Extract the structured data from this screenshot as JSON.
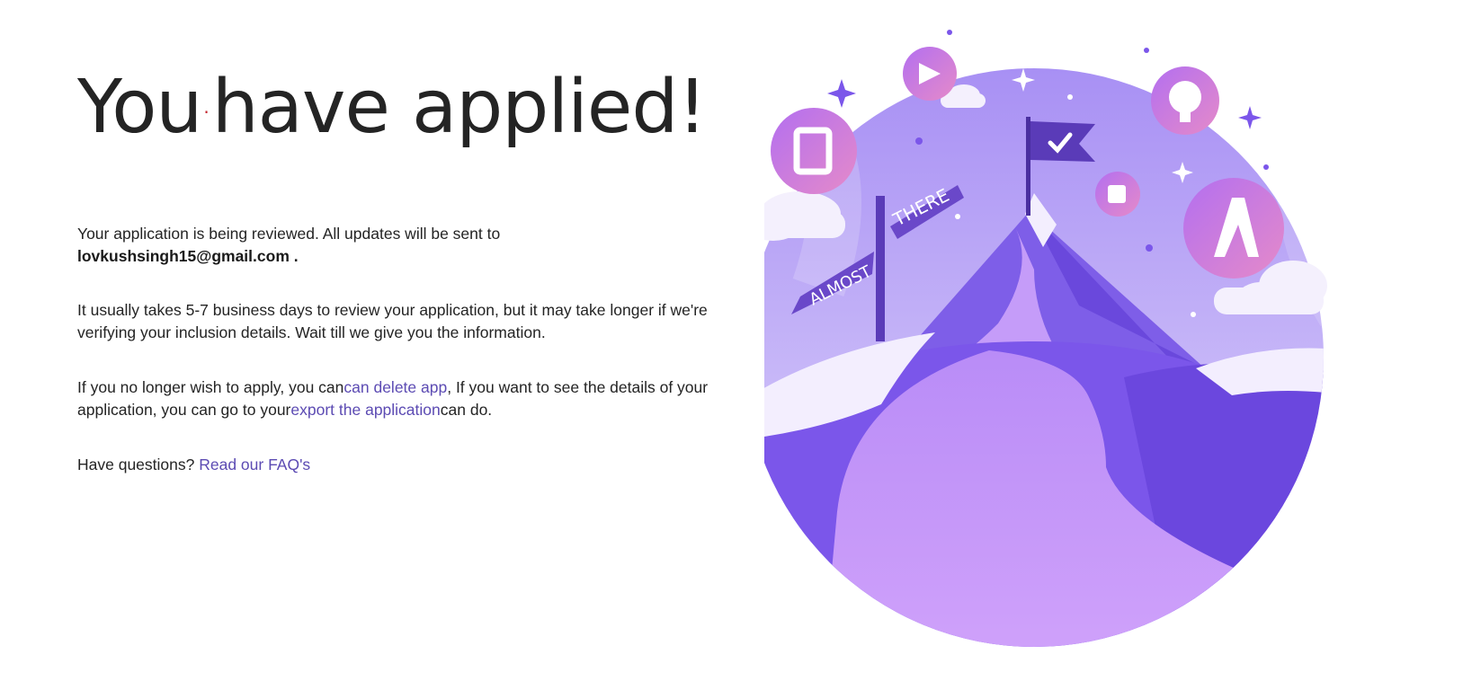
{
  "heading": {
    "word_1": "You",
    "dot": "·",
    "word_2": "have applied!"
  },
  "review": {
    "text": "Your application is being reviewed. All updates will be sent to",
    "email": "lovkushsingh15@gmail.com",
    "suffix": " ."
  },
  "timeline": {
    "text": "It usually takes 5-7 business days to review your application, but it may take longer if we're verifying your inclusion details. Wait till we give you the information."
  },
  "actions": {
    "text_1": "If you no longer wish to apply, you can",
    "delete_link": "can delete app",
    "text_2": ", If you want to see the details of your application, you can go to your",
    "export_link": "export the application",
    "text_3": "can do."
  },
  "faq": {
    "question": "Have questions? ",
    "link": "Read our FAQ's"
  },
  "illustration": {
    "sign_top": "THERE",
    "sign_bottom": "ALMOST",
    "icons": [
      "office-icon",
      "power-apps-icon",
      "github-icon",
      "teams-icon",
      "azure-icon"
    ]
  },
  "colors": {
    "link": "#5c4bb3",
    "accent_dot": "#c4262e",
    "illustration_primary": "#8b6cf0"
  }
}
